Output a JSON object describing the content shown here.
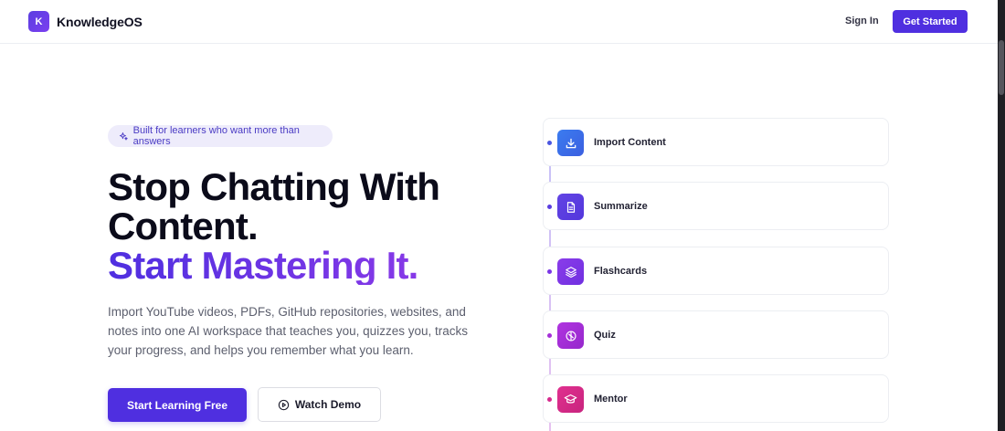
{
  "header": {
    "logo_letter": "K",
    "brand": "KnowledgeOS",
    "sign_in": "Sign In",
    "get_started": "Get Started"
  },
  "hero": {
    "badge": "Built for learners who want more than answers",
    "headline_line1": "Stop Chatting With",
    "headline_line2": "Content.",
    "headline_accent": "Start Mastering It.",
    "description": "Import YouTube videos, PDFs, GitHub repositories, websites, and notes into one AI workspace that teaches you, quizzes you, tracks your progress, and helps you remember what you learn.",
    "primary_cta": "Start Learning Free",
    "secondary_cta": "Watch Demo"
  },
  "steps": [
    {
      "label": "Import Content",
      "icon": "download-icon",
      "color": "#3b6fe8",
      "dot": "#4a56e0"
    },
    {
      "label": "Summarize",
      "icon": "document-icon",
      "color": "#5a3de0",
      "dot": "#5a3de0"
    },
    {
      "label": "Flashcards",
      "icon": "layers-icon",
      "color": "#7a36e6",
      "dot": "#7a36e6"
    },
    {
      "label": "Quiz",
      "icon": "brain-icon",
      "color": "#a52fd8",
      "dot": "#a52fd8"
    },
    {
      "label": "Mentor",
      "icon": "graduation-cap-icon",
      "color": "#d62a8e",
      "dot": "#d62a8e"
    }
  ],
  "colors": {
    "primary": "#4f2fe0",
    "accent_text": "#5a2ee0"
  }
}
